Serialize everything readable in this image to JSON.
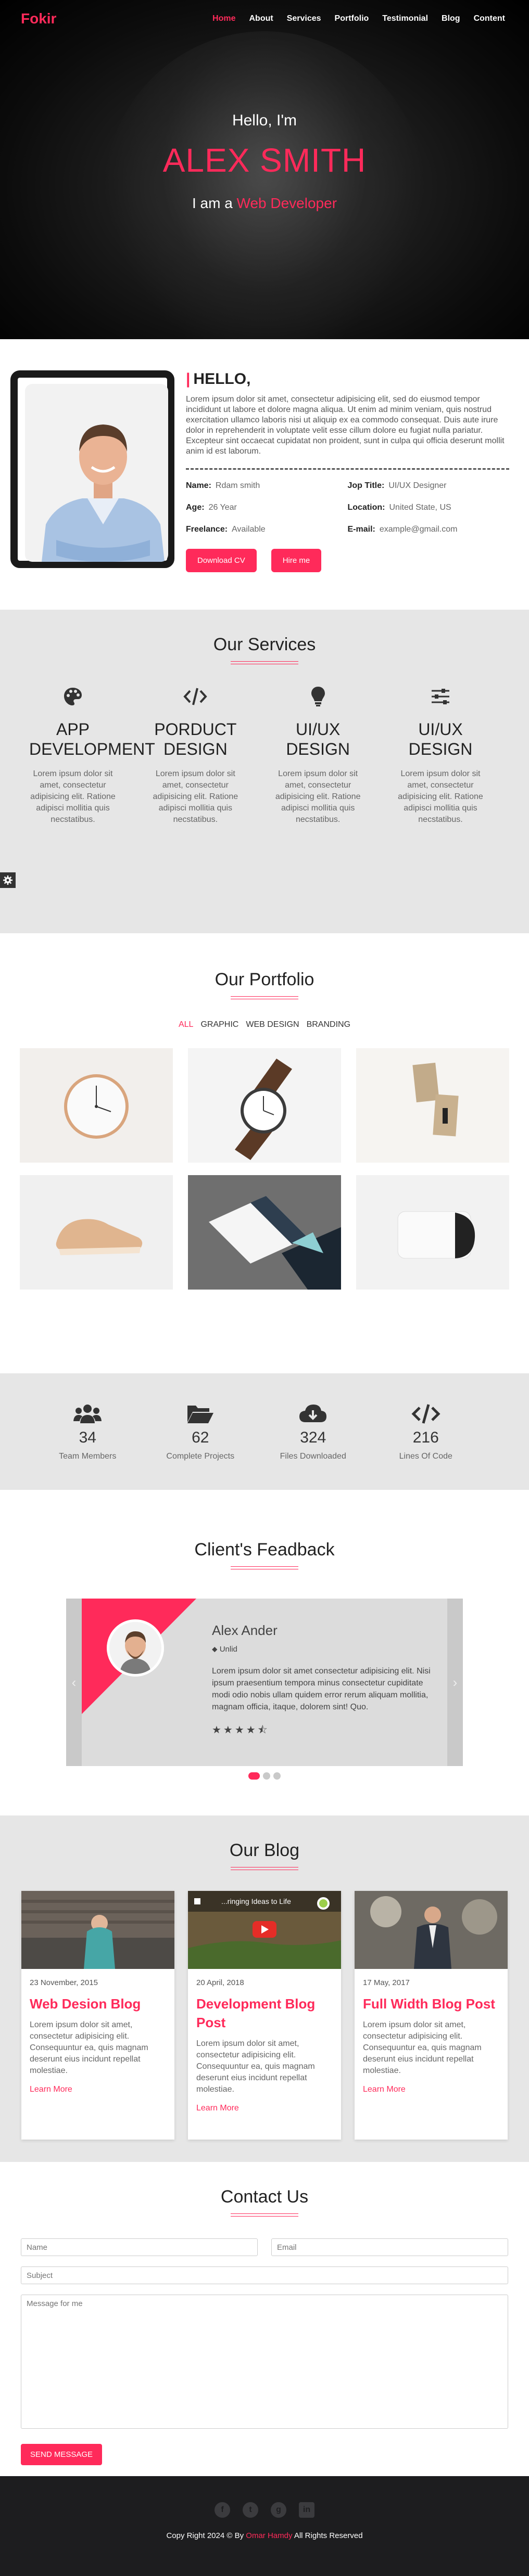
{
  "nav": {
    "brand": "Fokir",
    "items": [
      {
        "label": "Home",
        "active": true
      },
      {
        "label": "About"
      },
      {
        "label": "Services"
      },
      {
        "label": "Portfolio"
      },
      {
        "label": "Testimonial"
      },
      {
        "label": "Blog"
      },
      {
        "label": "Content"
      }
    ]
  },
  "hero": {
    "hello": "Hello, I'm",
    "name": "ALEX SMITH",
    "role_prefix": "I am a",
    "role_highlight": "Web Developer"
  },
  "about": {
    "heading": "HELLO,",
    "paragraph": "Lorem ipsum dolor sit amet, consectetur adipisicing elit, sed do eiusmod tempor incididunt ut labore et dolore magna aliqua. Ut enim ad minim veniam, quis nostrud exercitation ullamco laboris nisi ut aliquip ex ea commodo consequat. Duis aute irure dolor in reprehenderit in voluptate velit esse cillum dolore eu fugiat nulla pariatur. Excepteur sint occaecat cupidatat non proident, sunt in culpa qui officia deserunt mollit anim id est laborum.",
    "info": [
      {
        "label": "Name:",
        "value": "Rdam smith"
      },
      {
        "label": "Jop Title:",
        "value": "UI/UX Designer"
      },
      {
        "label": "Age:",
        "value": "26 Year"
      },
      {
        "label": "Location:",
        "value": "United State, US"
      },
      {
        "label": "Freelance:",
        "value": "Available"
      },
      {
        "label": "E-mail:",
        "value": "example@gmail.com"
      }
    ],
    "download_label": "Download CV",
    "hire_label": "Hire me"
  },
  "services": {
    "title": "Our Services",
    "items": [
      {
        "icon": "palette-icon",
        "title": "APP DEVELOPMENT",
        "desc": "Lorem ipsum dolor sit amet, consectetur adipisicing elit. Ratione adipisci mollitia quis necstatibus."
      },
      {
        "icon": "code-icon",
        "title": "PORDUCT DESIGN",
        "desc": "Lorem ipsum dolor sit amet, consectetur adipisicing elit. Ratione adipisci mollitia quis necstatibus."
      },
      {
        "icon": "lightbulb-icon",
        "title": "UI/UX DESIGN",
        "desc": "Lorem ipsum dolor sit amet, consectetur adipisicing elit. Ratione adipisci mollitia quis necstatibus."
      },
      {
        "icon": "sliders-icon",
        "title": "UI/UX DESIGN",
        "desc": "Lorem ipsum dolor sit amet, consectetur adipisicing elit. Ratione adipisci mollitia quis necstatibus."
      }
    ]
  },
  "portfolio": {
    "title": "Our Portfolio",
    "filters": [
      {
        "label": "ALL",
        "active": true
      },
      {
        "label": "GRAPHIC"
      },
      {
        "label": "WEB DESIGN"
      },
      {
        "label": "BRANDING"
      }
    ]
  },
  "counters": [
    {
      "icon": "users-icon",
      "value": "34",
      "label": "Team Members"
    },
    {
      "icon": "folder-open-icon",
      "value": "62",
      "label": "Complete Projects"
    },
    {
      "icon": "cloud-download-icon",
      "value": "324",
      "label": "Files Downloaded"
    },
    {
      "icon": "code-icon",
      "value": "216",
      "label": "Lines Of Code"
    }
  ],
  "feedback": {
    "title": "Client's Feadback",
    "name": "Alex Ander",
    "location": "Unlid",
    "text": "Lorem ipsum dolor sit amet consectetur adipisicing elit. Nisi ipsum praesentium tempora minus consectetur cupiditate modi odio nobis ullam quidem error rerum aliquam mollitia, magnam officia, itaque, dolorem sint! Quo.",
    "rating": 4.5
  },
  "blog": {
    "title": "Our Blog",
    "posts": [
      {
        "date": "23 November, 2015",
        "title": "Web Desion Blog",
        "text": "Lorem ipsum dolor sit amet, consectetur adipisicing elit. Consequuntur ea, quis magnam deserunt eius incidunt repellat molestiae.",
        "more": "Learn More"
      },
      {
        "date": "20 April, 2018",
        "title": "Development Blog Post",
        "text": "Lorem ipsum dolor sit amet, consectetur adipisicing elit. Consequuntur ea, quis magnam deserunt eius incidunt repellat molestiae.",
        "more": "Learn More",
        "video_title": "...ringing Ideas to Life"
      },
      {
        "date": "17 May, 2017",
        "title": "Full Width Blog Post",
        "text": "Lorem ipsum dolor sit amet, consectetur adipisicing elit. Consequuntur ea, quis magnam deserunt eius incidunt repellat molestiae.",
        "more": "Learn More"
      }
    ]
  },
  "contact": {
    "title": "Contact Us",
    "name_placeholder": "Name",
    "email_placeholder": "Email",
    "subject_placeholder": "Subject",
    "message_placeholder": "Message for me",
    "send_label": "SEND MESSAGE"
  },
  "footer": {
    "socials": [
      "facebook-icon",
      "twitter-icon",
      "github-icon",
      "linkedin-icon"
    ],
    "copy_prefix": "Copy Right 2024 © By",
    "copy_author": "Omar Hamdy",
    "copy_suffix": "All Rights Reserved"
  },
  "colors": {
    "accent": "#ff2a5a",
    "dark": "#1d1d1f",
    "band": "#e6e6e6"
  }
}
